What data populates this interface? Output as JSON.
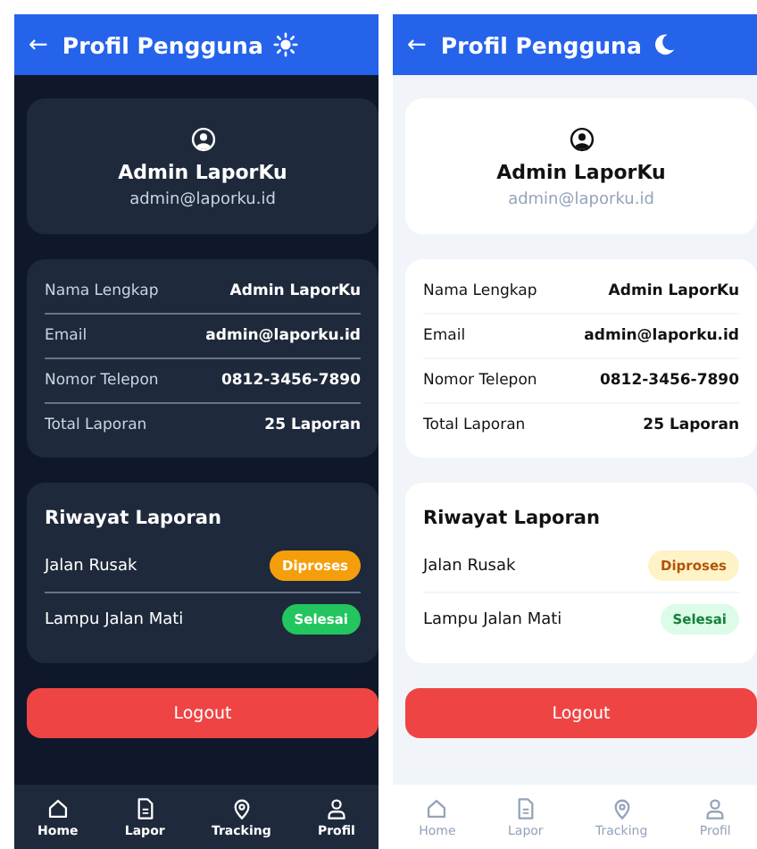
{
  "screens": [
    {
      "kind": "dark",
      "header": {
        "back": "←",
        "title": "Profil Pengguna"
      },
      "profile": {
        "name": "Admin LaporKu",
        "email": "admin@laporku.id"
      },
      "info": [
        {
          "label": "Nama Lengkap",
          "value": "Admin LaporKu"
        },
        {
          "label": "Email",
          "value": "admin@laporku.id"
        },
        {
          "label": "Nomor Telepon",
          "value": "0812-3456-7890"
        },
        {
          "label": "Total Laporan",
          "value": "25 Laporan"
        }
      ],
      "history": {
        "title": "Riwayat Laporan",
        "items": [
          {
            "name": "Jalan Rusak",
            "status": "Diproses",
            "kind": "processing"
          },
          {
            "name": "Lampu Jalan Mati",
            "status": "Selesai",
            "kind": "done"
          }
        ]
      },
      "logout": "Logout",
      "nav": [
        {
          "label": "Home"
        },
        {
          "label": "Lapor"
        },
        {
          "label": "Tracking"
        },
        {
          "label": "Profil"
        }
      ]
    },
    {
      "kind": "light",
      "header": {
        "back": "←",
        "title": "Profil Pengguna"
      },
      "profile": {
        "name": "Admin LaporKu",
        "email": "admin@laporku.id"
      },
      "info": [
        {
          "label": "Nama Lengkap",
          "value": "Admin LaporKu"
        },
        {
          "label": "Email",
          "value": "admin@laporku.id"
        },
        {
          "label": "Nomor Telepon",
          "value": "0812-3456-7890"
        },
        {
          "label": "Total Laporan",
          "value": "25 Laporan"
        }
      ],
      "history": {
        "title": "Riwayat Laporan",
        "items": [
          {
            "name": "Jalan Rusak",
            "status": "Diproses",
            "kind": "processing"
          },
          {
            "name": "Lampu Jalan Mati",
            "status": "Selesai",
            "kind": "done"
          }
        ]
      },
      "logout": "Logout",
      "nav": [
        {
          "label": "Home"
        },
        {
          "label": "Lapor"
        },
        {
          "label": "Tracking"
        },
        {
          "label": "Profil"
        }
      ]
    }
  ]
}
